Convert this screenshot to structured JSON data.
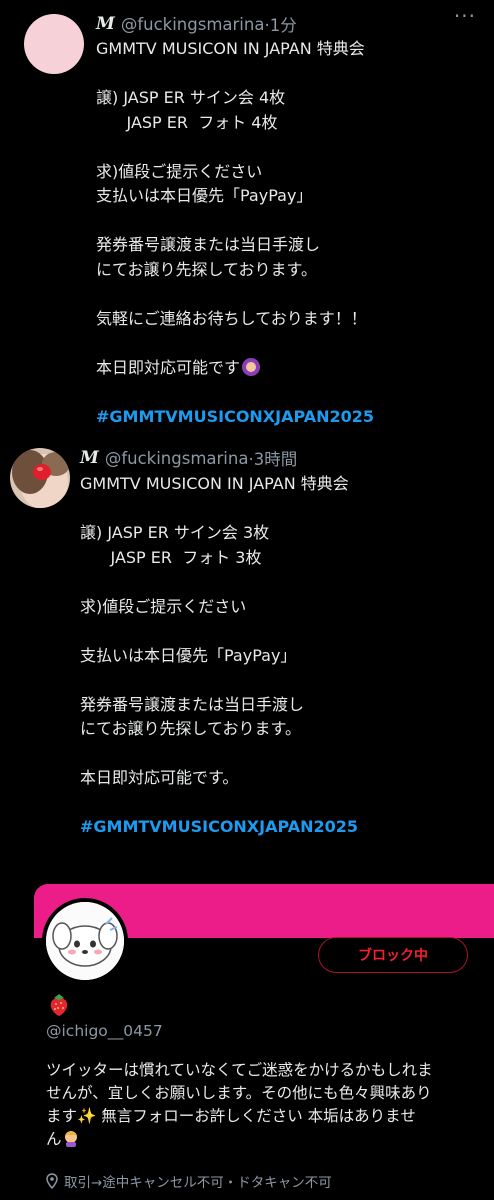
{
  "tweet1": {
    "handle": "@fuckingsmarina",
    "time": "·1分",
    "lines": [
      "GMMTV MUSICON IN JAPAN 特典会",
      "",
      "譲) JASP ER サイン会 4枚",
      "      JASP ER  フォト 4枚",
      "",
      "求)値段ご提示ください",
      "支払いは本日優先「PayPay」",
      "",
      "発券番号譲渡または当日手渡し",
      "にてお譲り先探しております。",
      "",
      "気軽にご連絡お待ちしております！！",
      "",
      "本日即対応可能です"
    ],
    "hashtag": "#GMMTVMUSICONXJAPAN2025"
  },
  "tweet2": {
    "handle": "@fuckingsmarina",
    "time": "·3時間",
    "lines": [
      "GMMTV MUSICON IN JAPAN 特典会",
      "",
      "譲) JASP ER サイン会 3枚",
      "      JASP ER  フォト 3枚",
      "",
      "求)値段ご提示ください",
      "",
      "支払いは本日優先「PayPay」",
      "",
      "発券番号譲渡または当日手渡し",
      "にてお譲り先探しております。",
      "",
      "本日即対応可能です。",
      ""
    ],
    "hashtag": "#GMMTVMUSICONXJAPAN2025"
  },
  "profile": {
    "block_label": "ブロック中",
    "handle": "@ichigo__0457",
    "bio_lines": [
      "ツイッターは慣れていなくてご迷惑をかけるかもしれま",
      "せんが、宜しくお願いします。その他にも色々興味あり",
      "ます✨ 無言フォローお許しください 本垢はありませ",
      "ん"
    ],
    "location": "取引→途中キャンセル不可・ドタキャン不可"
  },
  "colors": {
    "banner": "#ec1c88",
    "hashtag": "#1d9bf0",
    "block": "#f4212e"
  }
}
